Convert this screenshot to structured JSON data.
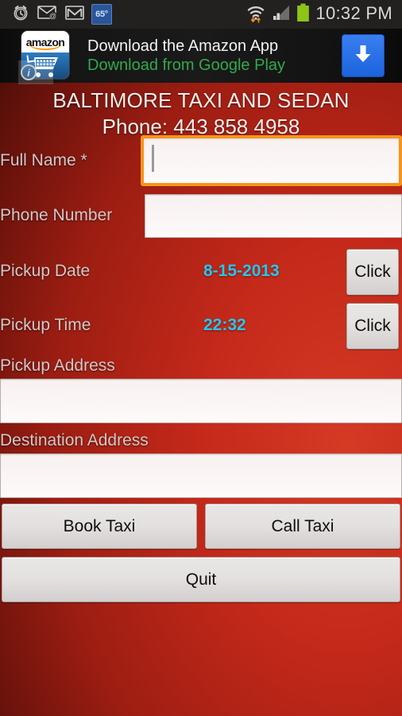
{
  "status_bar": {
    "icons": [
      "alarm-clock-icon",
      "email-at-icon",
      "gmail-icon"
    ],
    "weather_badge": "65°",
    "wifi_icon": "wifi-transfer-icon",
    "signal_icon": "cell-signal-icon",
    "battery_icon": "battery-full-icon",
    "clock": "10:32 PM"
  },
  "ad": {
    "icon_name": "amazon-app-icon",
    "icon_word": "amazon",
    "headline": "Download the Amazon App",
    "subline": "Download from Google Play",
    "cta_icon": "download-arrow-icon",
    "info_badge": "i"
  },
  "app": {
    "title": "BALTIMORE TAXI AND SEDAN",
    "phone_line": "Phone: 443 858 4958",
    "fields": {
      "full_name": {
        "label": "Full Name *",
        "value": "",
        "placeholder": "",
        "focused": true
      },
      "phone_number": {
        "label": "Phone Number",
        "value": "",
        "placeholder": ""
      },
      "pickup_date": {
        "label": "Pickup Date",
        "value": "8-15-2013",
        "button": "Click"
      },
      "pickup_time": {
        "label": "Pickup Time",
        "value": "22:32",
        "button": "Click"
      },
      "pickup_address": {
        "label": "Pickup Address",
        "value": "",
        "placeholder": ""
      },
      "destination_address": {
        "label": "Destination Address",
        "value": "",
        "placeholder": ""
      }
    },
    "buttons": {
      "book": "Book Taxi",
      "call": "Call Taxi",
      "quit": "Quit"
    },
    "colors": {
      "accent_value": "#26c6ef",
      "focus_border": "#f7941d",
      "background_red": "#c4291a",
      "ad_link_green": "#2faa4c",
      "ad_cta_blue": "#2673de"
    }
  }
}
